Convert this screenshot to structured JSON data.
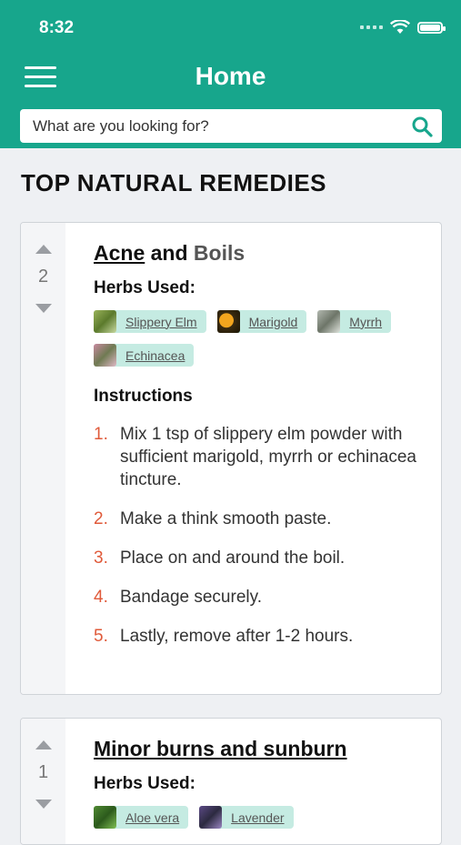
{
  "status": {
    "time": "8:32"
  },
  "header": {
    "title": "Home",
    "search_placeholder": "What are you looking for?"
  },
  "section_title": "TOP NATURAL REMEDIES",
  "colors": {
    "brand": "#17a68c",
    "chip_bg": "#c5ebe2",
    "step_number": "#e05a3a"
  },
  "remedies": [
    {
      "votes": "2",
      "title_parts": [
        "Acne",
        "and",
        "Boils"
      ],
      "herbs_heading": "Herbs Used:",
      "herbs": [
        {
          "name": "Slippery Elm",
          "icon": "slippery-elm-thumbnail"
        },
        {
          "name": "Marigold",
          "icon": "marigold-thumbnail"
        },
        {
          "name": "Myrrh",
          "icon": "myrrh-thumbnail"
        },
        {
          "name": "Echinacea",
          "icon": "echinacea-thumbnail"
        }
      ],
      "instructions_heading": "Instructions",
      "steps": [
        {
          "num": "1.",
          "text": "Mix 1 tsp of slippery elm powder with sufficient marigold, myrrh or echinacea tincture."
        },
        {
          "num": "2.",
          "text": "Make a think smooth paste."
        },
        {
          "num": "3.",
          "text": "Place on and around the boil."
        },
        {
          "num": "4.",
          "text": "Bandage securely."
        },
        {
          "num": "5.",
          "text": "Lastly, remove after 1-2 hours."
        }
      ]
    },
    {
      "votes": "1",
      "title": "Minor burns and sunburn",
      "herbs_heading": "Herbs Used:",
      "herbs": [
        {
          "name": "Aloe vera",
          "icon": "aloe-vera-thumbnail"
        },
        {
          "name": "Lavender",
          "icon": "lavender-thumbnail"
        }
      ]
    }
  ]
}
